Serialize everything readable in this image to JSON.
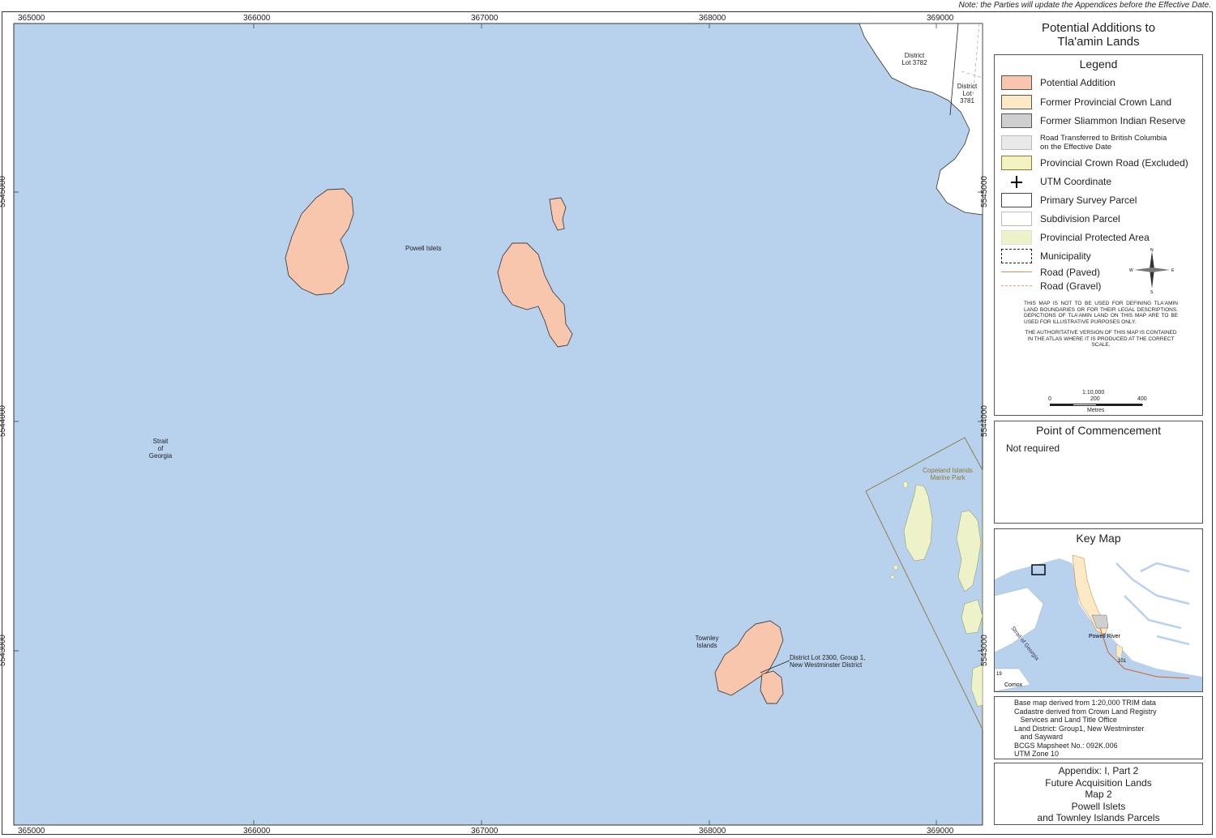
{
  "note": "Note:  the Parties will update the Appendices before the Effective Date.",
  "title": [
    "Potential Additions to",
    "Tla'amin Lands"
  ],
  "legend": {
    "heading": "Legend",
    "items": [
      {
        "label": "Potential Addition",
        "color": "#f8c6ad"
      },
      {
        "label": "Former Provincial Crown Land",
        "color": "#fde9c6"
      },
      {
        "label": "Former Sliammon Indian Reserve",
        "color": "#cfcfcf"
      },
      {
        "label": "Road Transferred to British Columbia on the Effective Date",
        "color": "#e9e9e9"
      },
      {
        "label": "Provincial Crown Road (Excluded)",
        "color": "#f2f2c2"
      },
      {
        "label": "UTM Coordinate",
        "color": "#000000"
      },
      {
        "label": "Primary Survey Parcel",
        "color": "#ffffff"
      },
      {
        "label": "Subdivision Parcel",
        "color": "#ffffff"
      },
      {
        "label": "Provincial Protected Area",
        "color": "#eef2c8"
      },
      {
        "label": "Municipality",
        "color": "#ffffff"
      },
      {
        "label": "Road (Paved)",
        "color": "#e08a5a"
      },
      {
        "label": "Road (Gravel)",
        "color": "#e0a080"
      }
    ],
    "north_arrow": {
      "n": "N",
      "s": "S",
      "e": "E",
      "w": "W"
    },
    "disclaimer_1": "This map is not to be used for defining Tla'amin land boundaries or for their legal descriptions. Depictions of Tla'amin land on this map are to be used for illustrative purposes only.",
    "disclaimer_2": "The authoritative version of this map is contained in the atlas where it is produced at the correct scale.",
    "scale": {
      "ratio": "1:10,000",
      "ticks": [
        "0",
        "200",
        "400"
      ],
      "unit": "Metres"
    }
  },
  "commencement": {
    "heading": "Point of Commencement",
    "text": "Not required"
  },
  "keymap": {
    "heading": "Key Map",
    "labels": [
      "Strait of Georgia",
      "Powell River",
      "Comox",
      "101",
      "19"
    ]
  },
  "info": [
    "Base map derived from 1:20,000 TRIM data",
    "Cadastre derived from Crown Land Registry",
    "   Services and Land Title Office",
    "Land District: Group1, New Westminster",
    "   and Sayward",
    "BCGS Mapsheet No.: 092K.006",
    "UTM Zone 10"
  ],
  "appendix": [
    "Appendix:  I, Part 2",
    "Future Acquisition Lands",
    "Map 2",
    "Powell Islets",
    "and Townley Islands Parcels"
  ],
  "map": {
    "x_ticks": [
      "365000",
      "366000",
      "367000",
      "368000",
      "369000"
    ],
    "y_ticks": [
      "5545000",
      "5544000",
      "5543000"
    ],
    "labels": {
      "powell": "Powell Islets",
      "strait": [
        "Strait",
        "of",
        "Georgia"
      ],
      "townley": [
        "Townley",
        "Islands"
      ],
      "dl2300": [
        "District Lot 2300, Group 1,",
        "New Westminster District"
      ],
      "dl3782": [
        "District",
        "Lot 3782"
      ],
      "dl3781": [
        "District",
        "Lot",
        "3781"
      ],
      "copeland": [
        "Copeland Islands",
        "Marine Park"
      ]
    },
    "colors": {
      "water": "#b8d1ec",
      "land": "#ffffff",
      "addition": "#f8c6ad",
      "park": "#eef2c8",
      "park_border": "#8a7a3a"
    }
  }
}
